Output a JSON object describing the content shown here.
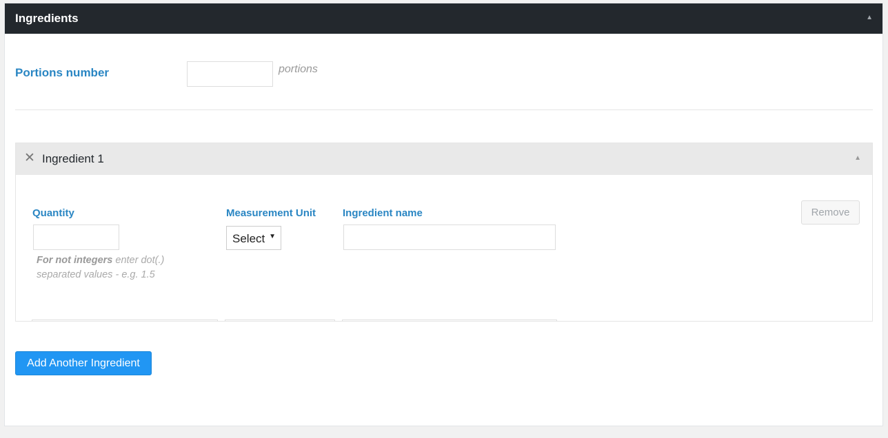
{
  "panel": {
    "title": "Ingredients",
    "toggle_icon": "triangle-up"
  },
  "portions": {
    "label": "Portions number",
    "value": "",
    "unit": "portions"
  },
  "ingredient": {
    "title": "Ingredient 1",
    "close_icon": "✕",
    "toggle_icon": "triangle-up",
    "quantity": {
      "label": "Quantity",
      "value": "",
      "help_bold": "For not integers",
      "help_text": " enter dot(.) separated values - e.g. 1.5"
    },
    "unit": {
      "label": "Measurement Unit",
      "selected": "Select"
    },
    "name": {
      "label": "Ingredient name",
      "value": ""
    },
    "remove_label": "Remove"
  },
  "actions": {
    "add_label": "Add Another Ingredient"
  },
  "colors": {
    "header_bg": "#23282d",
    "label_blue": "#2a86c3",
    "primary_button": "#2196f3"
  }
}
